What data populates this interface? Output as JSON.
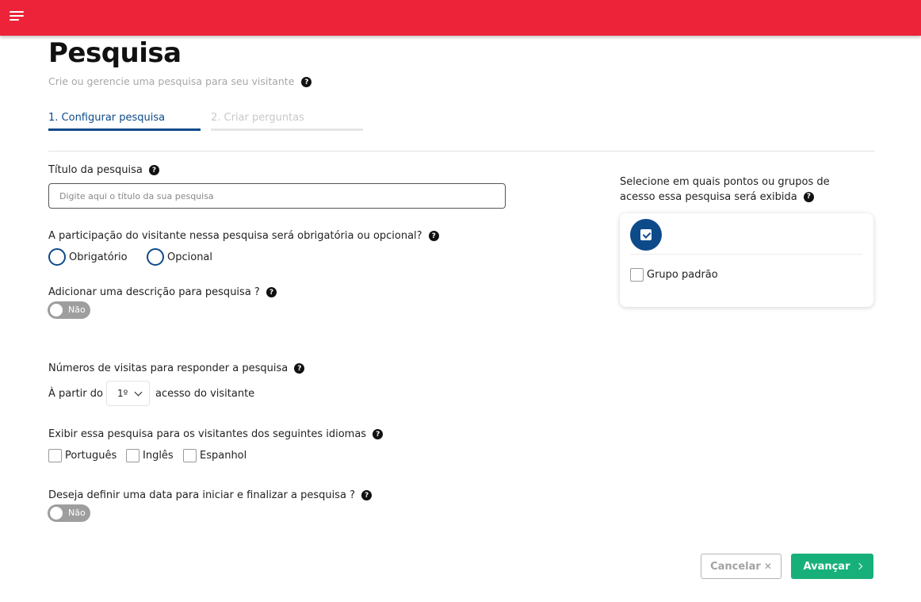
{
  "header": {
    "menu_icon": "hamburger-menu-icon",
    "color": "#ec2339"
  },
  "page": {
    "title": "Pesquisa",
    "subtitle": "Crie ou gerencie uma pesquisa para seu visitante"
  },
  "tabs": [
    {
      "label": "1. Configurar pesquisa",
      "active": true
    },
    {
      "label": "2. Criar perguntas",
      "active": false
    }
  ],
  "form": {
    "title_label": "Título da pesquisa",
    "title_placeholder": "Digite aqui o título da sua pesquisa",
    "participation_label": "A participação do visitante nessa pesquisa será obrigatória ou opcional?",
    "participation_options": [
      "Obrigatório",
      "Opcional"
    ],
    "description_label": "Adicionar uma descrição para pesquisa ?",
    "description_toggle": "Não",
    "visits_label": "Números de visitas para responder a pesquisa",
    "visits_prefix": "À partir do",
    "visits_value": "1º",
    "visits_suffix": "acesso do visitante",
    "languages_label": "Exibir essa pesquisa para os visitantes dos seguintes idiomas",
    "languages": [
      "Português",
      "Inglês",
      "Espanhol"
    ],
    "date_label": "Deseja definir uma data para iniciar e finalizar a pesquisa ?",
    "date_toggle": "Não"
  },
  "groups": {
    "label_line1": "Selecione em quais pontos ou grupos de",
    "label_line2": "acesso essa pesquisa será exibida",
    "items": [
      "Grupo padrão"
    ]
  },
  "actions": {
    "cancel": "Cancelar",
    "next": "Avançar"
  },
  "colors": {
    "primary": "#0d4a8a",
    "success": "#18b07a",
    "toggle_off": "#9e9e9e"
  }
}
